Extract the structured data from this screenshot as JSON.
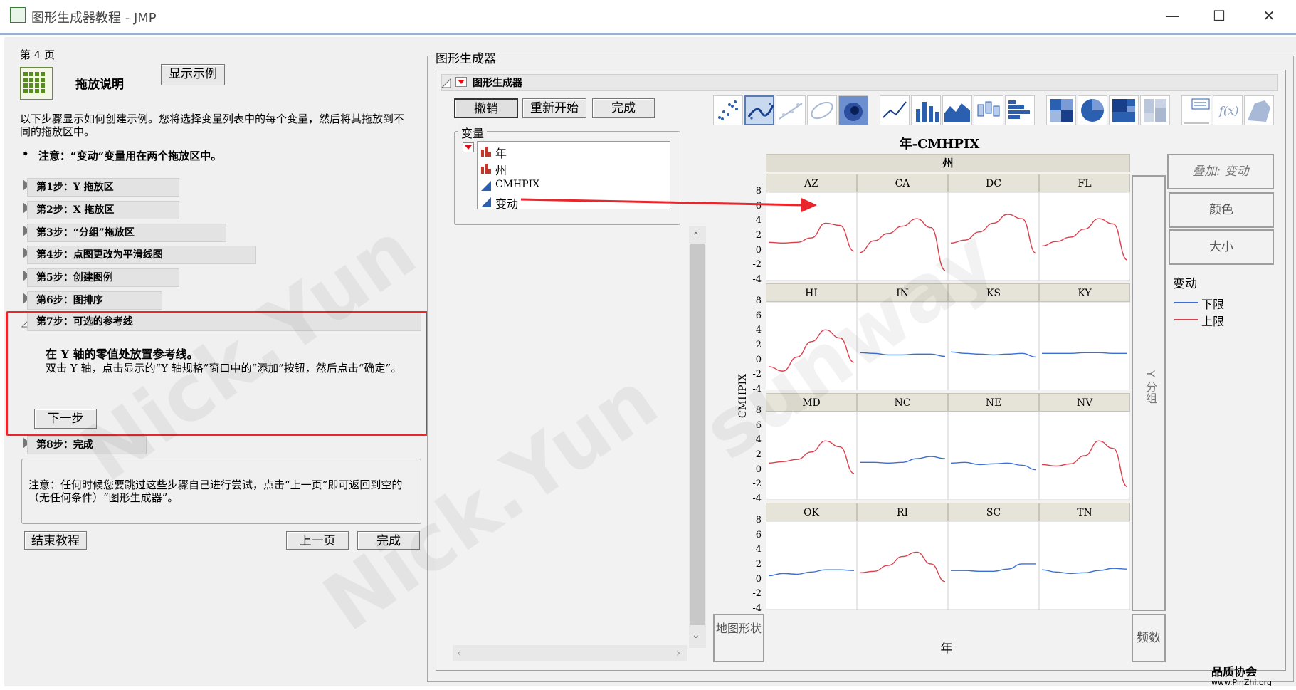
{
  "window": {
    "title": "图形生成器教程 - JMP",
    "minimize": "—",
    "maximize": "☐",
    "close": "✕"
  },
  "tutorial": {
    "page_label": "第 4 页",
    "section_title": "拖放说明",
    "show_example_button": "显示示例",
    "intro": "以下步骤显示如何创建示例。您将选择变量列表中的每个变量，然后将其拖放到不同的拖放区中。",
    "note": "注意：“变动”变量用在两个拖放区中。",
    "steps": [
      {
        "label": "第1步：Y 拖放区"
      },
      {
        "label": "第2步：X 拖放区"
      },
      {
        "label": "第3步：“分组”拖放区"
      },
      {
        "label": "第4步：点图更改为平滑线图"
      },
      {
        "label": "第5步：创建图例"
      },
      {
        "label": "第6步：图排序"
      },
      {
        "label": "第7步：可选的参考线"
      },
      {
        "label": "第8步：完成"
      }
    ],
    "step7_heading": "在 Y 轴的零值处放置参考线。",
    "step7_body": "双击 Y 轴，点击显示的“Y 轴规格”窗口中的“添加”按钮，然后点击“确定”。",
    "next_button": "下一步",
    "footer_note": "注意：任何时候您要跳过这些步骤自己进行尝试，点击“上一页”即可返回到空的（无任何条件）“图形生成器”。",
    "end_button": "结束教程",
    "prev_button": "上一页",
    "done_button": "完成"
  },
  "builder": {
    "group_title": "图形生成器",
    "panel_title": "图形生成器",
    "undo": "撤销",
    "restart": "重新开始",
    "done": "完成",
    "variables_label": "变量",
    "variables": [
      "年",
      "州",
      "CMHPIX",
      "变动"
    ],
    "graph_title": "年-CMHPIX",
    "group_x_label": "州",
    "y_axis_label": "CMHPIX",
    "x_axis_label": "年",
    "group_y_label": "Y 分组",
    "map_shape": "地图形状",
    "freq": "频数",
    "overlay": "叠加: 变动",
    "color": "颜色",
    "size": "大小",
    "legend_title": "变动",
    "legend": [
      {
        "name": "下限",
        "color": "#3b6fd6"
      },
      {
        "name": "上限",
        "color": "#d9414e"
      }
    ],
    "y_ticks": [
      "8",
      "6",
      "4",
      "2",
      "0",
      "-2",
      "-4"
    ],
    "states": [
      "AZ",
      "CA",
      "DC",
      "FL",
      "HI",
      "IN",
      "KS",
      "KY",
      "MD",
      "NC",
      "NE",
      "NV",
      "OK",
      "RI",
      "SC",
      "TN"
    ]
  },
  "watermarks": {
    "corner_brand": "品质协会",
    "corner_url": "www.PinZhi.org"
  },
  "chart_data": {
    "type": "line",
    "title": "年-CMHPIX",
    "xlabel": "年",
    "ylabel": "CMHPIX",
    "ylim": [
      -4,
      8
    ],
    "panels": [
      {
        "state": "AZ",
        "series": "上限",
        "values": [
          1.2,
          1.1,
          1.2,
          1.8,
          3.8,
          3.5,
          0.0
        ]
      },
      {
        "state": "CA",
        "series": "上限",
        "values": [
          -0.2,
          1.4,
          2.4,
          3.4,
          4.4,
          3.2,
          -2.6
        ]
      },
      {
        "state": "DC",
        "series": "上限",
        "values": [
          1.1,
          1.5,
          2.6,
          3.8,
          5.0,
          4.4,
          -0.3
        ]
      },
      {
        "state": "FL",
        "series": "上限",
        "values": [
          0.7,
          1.3,
          1.9,
          3.0,
          4.4,
          3.7,
          -1.2
        ]
      },
      {
        "state": "HI",
        "series": "上限",
        "values": [
          -0.8,
          -1.4,
          0.5,
          2.6,
          4.2,
          3.1,
          -0.2
        ]
      },
      {
        "state": "IN",
        "series": "下限",
        "values": [
          1.1,
          1.0,
          0.8,
          0.8,
          0.9,
          0.9,
          0.6
        ]
      },
      {
        "state": "KS",
        "series": "下限",
        "values": [
          1.2,
          1.0,
          0.9,
          0.8,
          0.9,
          1.0,
          0.5
        ]
      },
      {
        "state": "KY",
        "series": "下限",
        "values": [
          1.0,
          1.0,
          1.0,
          1.1,
          1.1,
          1.0,
          1.0
        ]
      },
      {
        "state": "MD",
        "series": "上限",
        "values": [
          1.0,
          1.2,
          1.5,
          2.5,
          4.0,
          3.2,
          -0.4
        ]
      },
      {
        "state": "NC",
        "series": "下限",
        "values": [
          1.1,
          1.1,
          1.0,
          1.1,
          1.6,
          1.9,
          1.6
        ]
      },
      {
        "state": "NE",
        "series": "下限",
        "values": [
          1.0,
          1.1,
          0.8,
          0.9,
          1.0,
          0.7,
          0.1
        ]
      },
      {
        "state": "NV",
        "series": "上限",
        "values": [
          0.8,
          0.6,
          0.9,
          2.0,
          4.0,
          3.0,
          -2.2
        ]
      },
      {
        "state": "OK",
        "series": "下限",
        "values": [
          0.6,
          0.9,
          0.8,
          1.1,
          1.4,
          1.4,
          1.3
        ]
      },
      {
        "state": "RI",
        "series": "上限",
        "values": [
          1.0,
          1.2,
          2.0,
          3.2,
          3.8,
          2.2,
          -0.2
        ]
      },
      {
        "state": "SC",
        "series": "下限",
        "values": [
          1.3,
          1.3,
          1.2,
          1.2,
          1.5,
          2.2,
          2.2
        ]
      },
      {
        "state": "TN",
        "series": "下限",
        "values": [
          1.4,
          1.1,
          0.9,
          1.0,
          1.3,
          1.6,
          1.5
        ]
      }
    ]
  }
}
